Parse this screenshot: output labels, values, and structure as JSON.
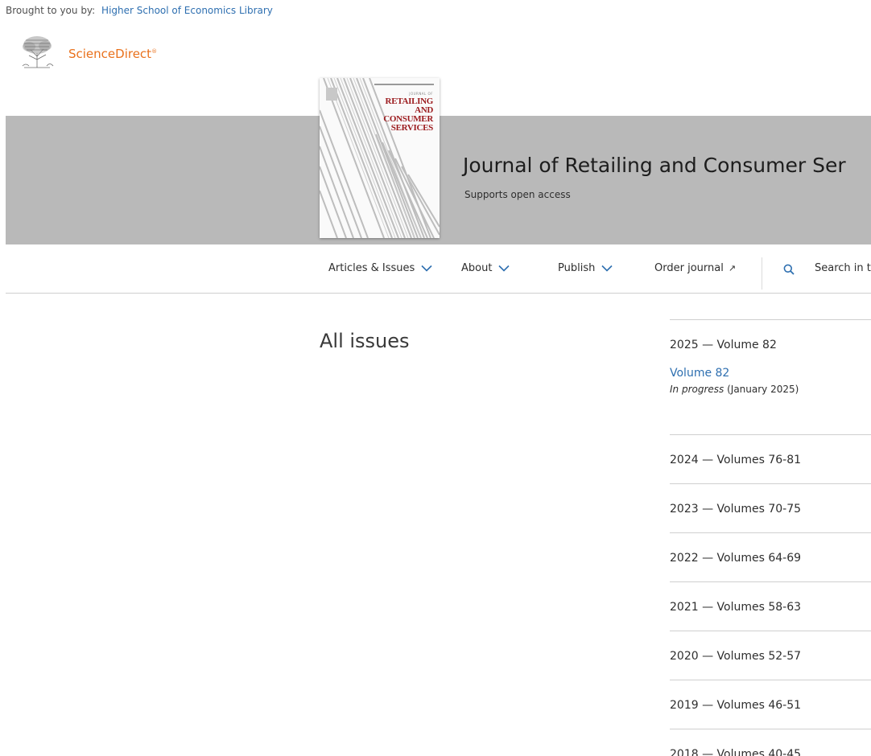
{
  "header": {
    "brought_label": "Brought to you by:",
    "institution": "Higher School of Economics Library",
    "brand": "ScienceDirect",
    "brand_mark": "®"
  },
  "journal": {
    "title": "Journal of Retailing and Consumer Ser",
    "subtitle": "Supports open access",
    "cover": {
      "journal_of": "JOURNAL OF",
      "line1": "RETAILING",
      "line2": "AND",
      "line3": "CONSUMER",
      "line4": "SERVICES"
    }
  },
  "nav": {
    "articles": "Articles & Issues",
    "about": "About",
    "publish": "Publish",
    "order": "Order journal",
    "order_icon": "↗",
    "search_placeholder": "Search in t"
  },
  "main": {
    "heading": "All issues",
    "groups": [
      {
        "year": "2025 — Volume 82",
        "volume_link": "Volume 82",
        "status_italic": "In progress",
        "status_rest": " (January 2025)"
      },
      {
        "year": "2024 — Volumes 76-81"
      },
      {
        "year": "2023 — Volumes 70-75"
      },
      {
        "year": "2022 — Volumes 64-69"
      },
      {
        "year": "2021 — Volumes 58-63"
      },
      {
        "year": "2020 — Volumes 52-57"
      },
      {
        "year": "2019 — Volumes 46-51"
      },
      {
        "year": "2018 — Volumes 40-45"
      }
    ]
  },
  "colors": {
    "accent": "#2e6fb0",
    "brand": "#e9711c",
    "banner": "#b9b9b9"
  }
}
